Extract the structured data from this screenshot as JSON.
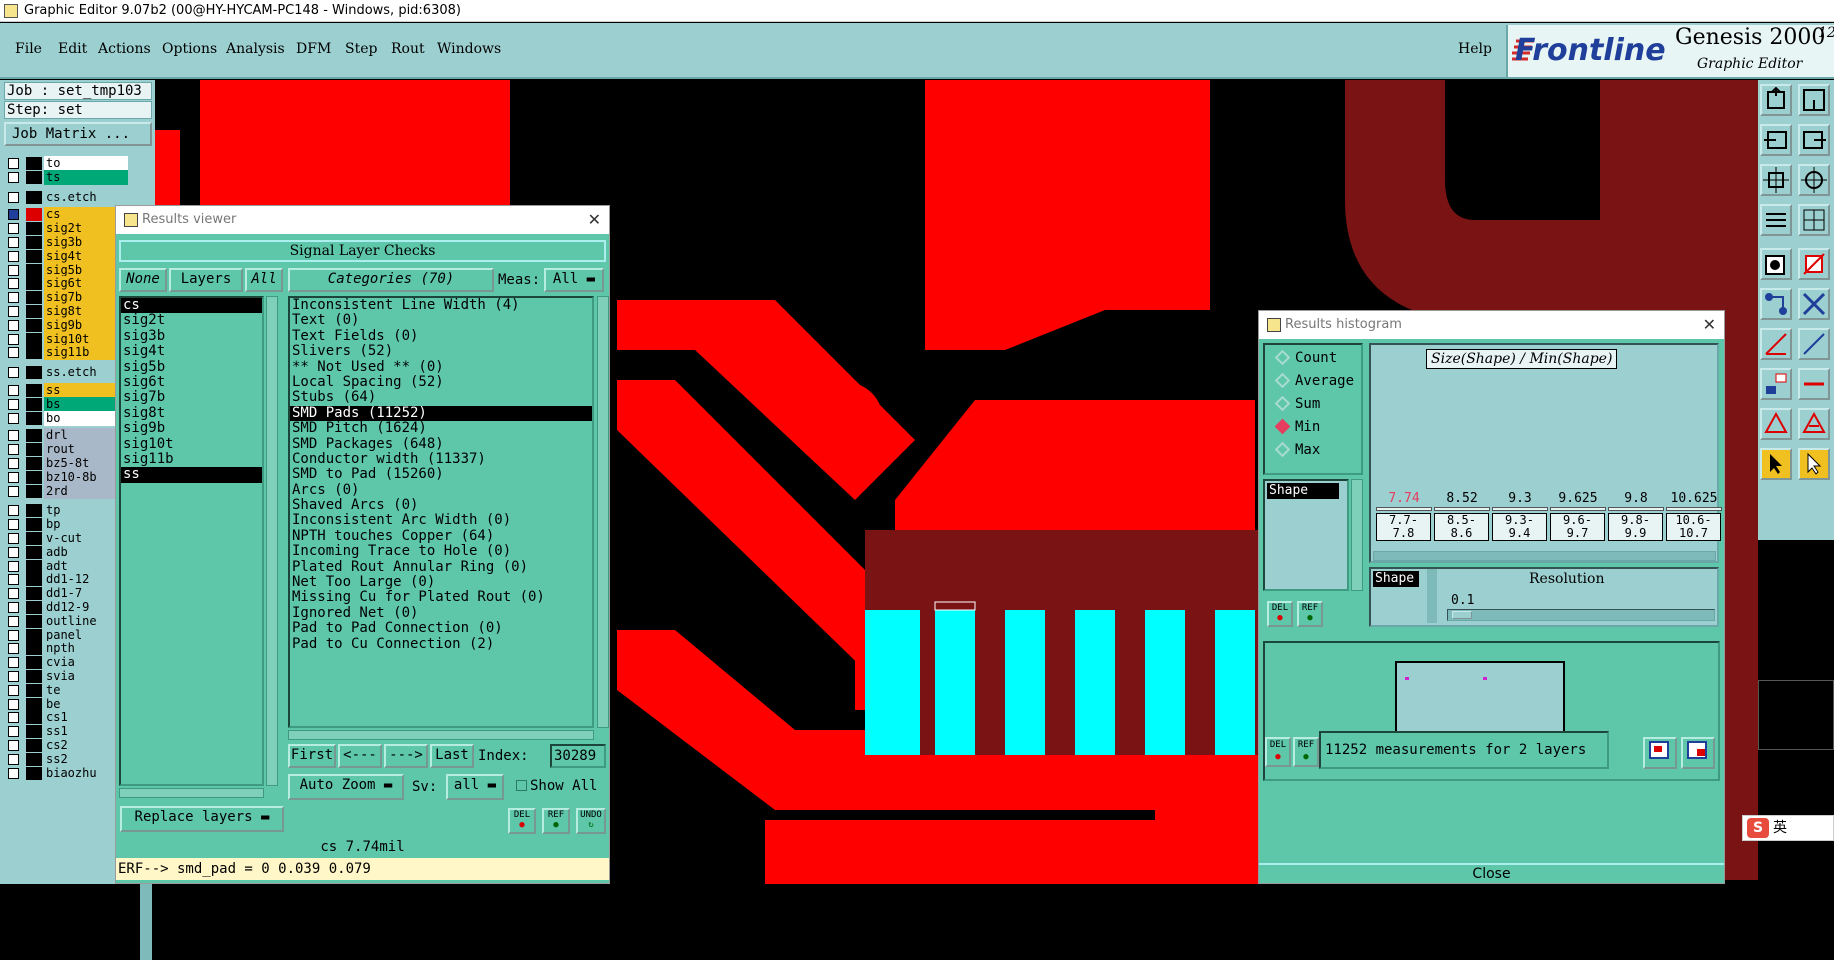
{
  "window_title": "Graphic Editor 9.07b2 (00@HY-HYCAM-PC148 - Windows, pid:6308)",
  "menu": [
    "File",
    "Edit",
    "Actions",
    "Options",
    "Analysis",
    "DFM",
    "Step",
    "Rout",
    "Windows"
  ],
  "help_label": "Help",
  "brand": {
    "logo": "Frontline",
    "product": "Genesis 2000",
    "version_fragment": "12",
    "subtitle": "Graphic Editor"
  },
  "left": {
    "job": "Job : set_tmp103",
    "step": "Step: set",
    "job_matrix": "Job Matrix ...",
    "layers": [
      {
        "name": "to",
        "color": "#ffffff"
      },
      {
        "name": "ts",
        "color": "#00a878"
      },
      {
        "name": "cs.etch",
        "color": "#9ccfd0"
      },
      {
        "name": "cs",
        "color": "#f0c020"
      },
      {
        "name": "sig2t",
        "color": "#f0c020"
      },
      {
        "name": "sig3b",
        "color": "#f0c020"
      },
      {
        "name": "sig4t",
        "color": "#f0c020"
      },
      {
        "name": "sig5b",
        "color": "#f0c020"
      },
      {
        "name": "sig6t",
        "color": "#f0c020"
      },
      {
        "name": "sig7b",
        "color": "#f0c020"
      },
      {
        "name": "sig8t",
        "color": "#f0c020"
      },
      {
        "name": "sig9b",
        "color": "#f0c020"
      },
      {
        "name": "sig10t",
        "color": "#f0c020"
      },
      {
        "name": "sig11b",
        "color": "#f0c020"
      },
      {
        "name": "ss.etch",
        "color": "#9ccfd0"
      },
      {
        "name": "ss",
        "color": "#f0c020"
      },
      {
        "name": "bs",
        "color": "#00a878"
      },
      {
        "name": "bo",
        "color": "#ffffff"
      },
      {
        "name": "drl",
        "color": "#a8b8c8"
      },
      {
        "name": "rout",
        "color": "#a8b8c8"
      },
      {
        "name": "bz5-8t",
        "color": "#a8b8c8"
      },
      {
        "name": "bz10-8b",
        "color": "#a8b8c8"
      },
      {
        "name": "2rd",
        "color": "#a8b8c8"
      },
      {
        "name": "tp",
        "color": "#9ccfd0"
      },
      {
        "name": "bp",
        "color": "#9ccfd0"
      },
      {
        "name": "v-cut",
        "color": "#9ccfd0"
      },
      {
        "name": "adb",
        "color": "#9ccfd0"
      },
      {
        "name": "adt",
        "color": "#9ccfd0"
      },
      {
        "name": "dd1-12",
        "color": "#9ccfd0"
      },
      {
        "name": "dd1-7",
        "color": "#9ccfd0"
      },
      {
        "name": "dd12-9",
        "color": "#9ccfd0"
      },
      {
        "name": "outline",
        "color": "#9ccfd0"
      },
      {
        "name": "panel",
        "color": "#9ccfd0"
      },
      {
        "name": "npth",
        "color": "#9ccfd0"
      },
      {
        "name": "cvia",
        "color": "#9ccfd0"
      },
      {
        "name": "svia",
        "color": "#9ccfd0"
      },
      {
        "name": "te",
        "color": "#9ccfd0"
      },
      {
        "name": "be",
        "color": "#9ccfd0"
      },
      {
        "name": "cs1",
        "color": "#9ccfd0"
      },
      {
        "name": "ss1",
        "color": "#9ccfd0"
      },
      {
        "name": "cs2",
        "color": "#9ccfd0"
      },
      {
        "name": "ss2",
        "color": "#9ccfd0"
      },
      {
        "name": "biaozhu",
        "color": "#9ccfd0"
      }
    ]
  },
  "results_viewer": {
    "title": "Results viewer",
    "header": "Signal Layer Checks",
    "none_btn": "None",
    "layers_btn": "Layers",
    "all_btn": "All",
    "categories_btn": "Categories (70)",
    "meas_label": "Meas:",
    "meas_value": "All",
    "layer_list": [
      "cs",
      "sig2t",
      "sig3b",
      "sig4t",
      "sig5b",
      "sig6t",
      "sig7b",
      "sig8t",
      "sig9b",
      "sig10t",
      "sig11b",
      "ss"
    ],
    "category_list": [
      "Inconsistent Line Width (4)",
      "Text (0)",
      "Text Fields (0)",
      "Slivers (52)",
      "** Not Used ** (0)",
      "Local Spacing (52)",
      "Stubs (64)",
      "SMD Pads (11252)",
      "SMD Pitch (1624)",
      "SMD Packages (648)",
      "Conductor width (11337)",
      "SMD to Pad (15260)",
      "Arcs (0)",
      "Shaved Arcs (0)",
      "Inconsistent Arc Width (0)",
      "NPTH touches Copper (64)",
      "Incoming Trace to Hole (0)",
      "Plated Rout Annular Ring (0)",
      "Net Too Large (0)",
      "Missing Cu for Plated Rout (0)",
      "Ignored Net (0)",
      "Pad to Pad Connection (0)",
      "Pad to Cu Connection (2)"
    ],
    "first_btn": "First",
    "prev_btn": "<---",
    "next_btn": "--->",
    "last_btn": "Last",
    "index_label": "Index:",
    "index_value": "30289",
    "auto_zoom": "Auto Zoom",
    "sv_label": "Sv:",
    "sv_value": "all",
    "show_all": "Show All",
    "replace_layers": "Replace layers",
    "del_btn": "DEL",
    "ref_btn": "REF",
    "undo_btn": "UNDO",
    "status": "cs 7.74mil",
    "erf": "ERF--> smd_pad = 0 0.039 0.079"
  },
  "histogram": {
    "title": "Results histogram",
    "modes": [
      {
        "label": "Count",
        "selected": false
      },
      {
        "label": "Average",
        "selected": false
      },
      {
        "label": "Sum",
        "selected": false
      },
      {
        "label": "Min",
        "selected": true
      },
      {
        "label": "Max",
        "selected": false
      }
    ],
    "plot_title": "Size(Shape) / Min(Shape)",
    "bins": [
      {
        "top": "7.74",
        "range": "7.7-\n7.8"
      },
      {
        "top": "8.52",
        "range": "8.5-\n8.6"
      },
      {
        "top": "9.3",
        "range": "9.3-\n9.4"
      },
      {
        "top": "9.625",
        "range": "9.6-\n9.7"
      },
      {
        "top": "9.8",
        "range": "9.8-\n9.9"
      },
      {
        "top": "10.625",
        "range": "10.6-\n10.7"
      }
    ],
    "shape_list_item": "Shape",
    "shape_label": "Shape",
    "resolution_label": "Resolution",
    "resolution_value": "0.1",
    "del_btn": "DEL",
    "ref_btn": "REF",
    "measurements": "11252 measurements for 2 layers",
    "close_btn": "Close",
    "highlight_color": "#e53e5e"
  },
  "ime": {
    "logo": "S",
    "label": "英"
  }
}
